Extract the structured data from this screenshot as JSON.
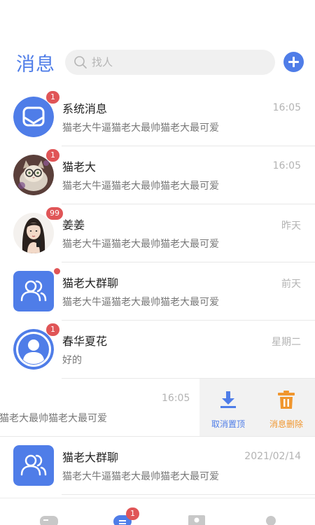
{
  "header": {
    "title": "消息",
    "search_placeholder": "找人"
  },
  "conversations": [
    {
      "name": "系统消息",
      "time": "16:05",
      "preview": "猫老大牛逼猫老大最帅猫老大最可爱",
      "badge": "1",
      "avatar": "system-message-icon"
    },
    {
      "name": "猫老大",
      "time": "16:05",
      "preview": "猫老大牛逼猫老大最帅猫老大最可爱",
      "badge": "1",
      "avatar": "cat-photo"
    },
    {
      "name": "姜姜",
      "time": "昨天",
      "preview": "猫老大牛逼猫老大最帅猫老大最可爱",
      "badge": "99",
      "avatar": "girl-photo"
    },
    {
      "name": "猫老大群聊",
      "time": "前天",
      "preview": "猫老大牛逼猫老大最帅猫老大最可爱",
      "badge": "",
      "avatar": "group-icon"
    },
    {
      "name": "春华夏花",
      "time": "星期二",
      "preview": "好的",
      "badge": "1",
      "avatar": "user-icon"
    }
  ],
  "swiped_row": {
    "time": "16:05",
    "preview": "猫老大最帅猫老大最可爱",
    "unpin_label": "取消置顶",
    "delete_label": "消息删除"
  },
  "last_row": {
    "name": "猫老大群聊",
    "time": "2021/02/14",
    "preview": "猫老大牛逼猫老大最帅猫老大最可爱",
    "avatar": "group-icon"
  },
  "tabbar": {
    "tabs": [
      "game-controller-icon",
      "message-icon",
      "contacts-icon",
      "profile-icon"
    ],
    "message_badge": "1",
    "active_tab": "message-icon"
  },
  "colors": {
    "accent": "#4f7de8",
    "badge": "#e05557",
    "delete": "#f0962e"
  }
}
